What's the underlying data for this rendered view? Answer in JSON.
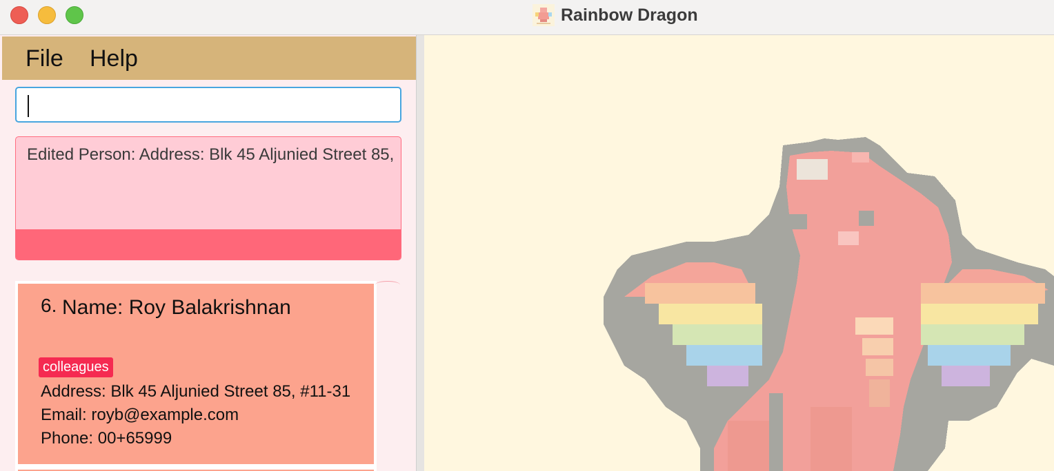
{
  "window": {
    "title": "Rainbow Dragon",
    "app_icon": "dragon-app-icon"
  },
  "menu": {
    "file_label": "File",
    "help_label": "Help"
  },
  "command_box": {
    "value": ""
  },
  "result_display": {
    "text": "Edited Person: Address: Blk 45 Aljunied Street 85,"
  },
  "person_list": {
    "cards": [
      {
        "index": "6.",
        "name": "Name: Roy Balakrishnan",
        "tags": [
          "colleagues"
        ],
        "address": "Address: Blk 45 Aljunied Street 85, #11-31",
        "email": "Email: royb@example.com",
        "phone": "Phone: 00+65999"
      }
    ]
  },
  "colors": {
    "menubar": "#d6b47a",
    "left_pane_bg": "#fdeef0",
    "result_bg": "#ffccd6",
    "result_accent": "#ff6779",
    "card_bg": "#fca38d",
    "tag_bg": "#f52a51",
    "right_pane_bg": "#fff7df"
  },
  "right_pane": {
    "image": "rainbow-dragon-pixel-art"
  }
}
